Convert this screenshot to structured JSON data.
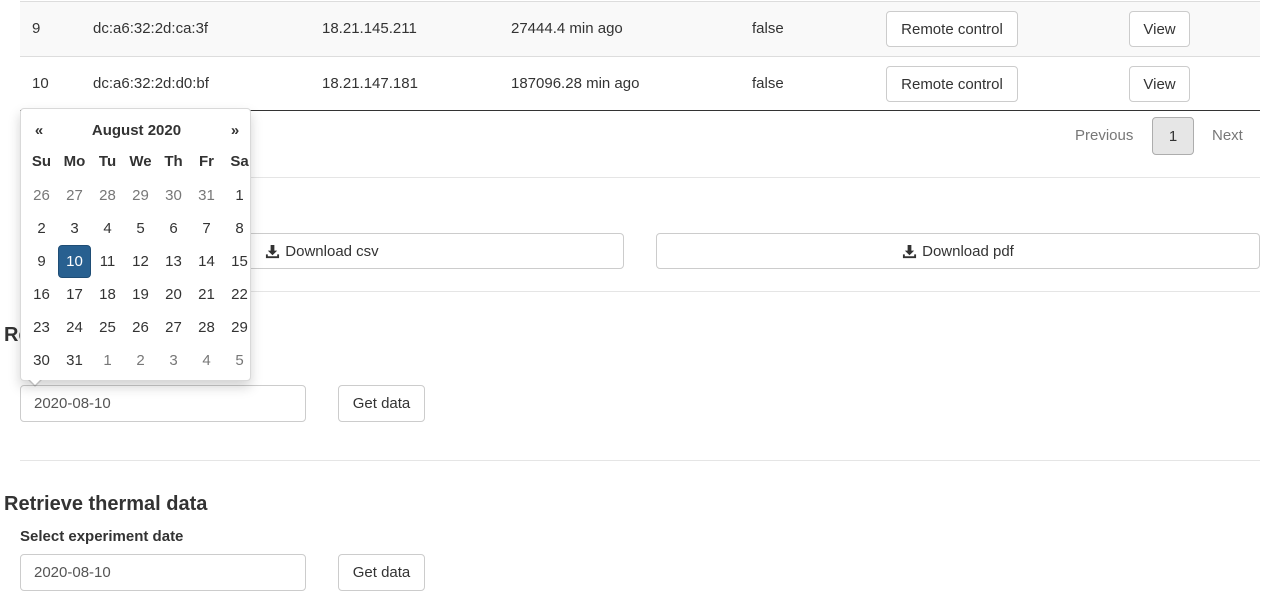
{
  "table": {
    "rows": [
      {
        "idx": "9",
        "mac": "dc:a6:32:2d:ca:3f",
        "ip": "18.21.145.211",
        "last_seen": "27444.4 min ago",
        "status": "false",
        "remote_label": "Remote control",
        "view_label": "View"
      },
      {
        "idx": "10",
        "mac": "dc:a6:32:2d:d0:bf",
        "ip": "18.21.147.181",
        "last_seen": "187096.28 min ago",
        "status": "false",
        "remote_label": "Remote control",
        "view_label": "View"
      }
    ]
  },
  "pagination": {
    "previous": "Previous",
    "current_page": "1",
    "next": "Next"
  },
  "downloads": {
    "csv_label": "Download csv",
    "pdf_label": "Download pdf",
    "icon": "download-icon"
  },
  "section_partial": {
    "title_visible": "Re",
    "date_value": "2020-08-10",
    "get_data_label": "Get data"
  },
  "thermal": {
    "title": "Retrieve thermal data",
    "date_label": "Select experiment date",
    "date_value": "2020-08-10",
    "get_data_label": "Get data"
  },
  "datepicker": {
    "prev": "«",
    "next": "»",
    "month_title": "August 2020",
    "weekdays": [
      "Su",
      "Mo",
      "Tu",
      "We",
      "Th",
      "Fr",
      "Sa"
    ],
    "weeks": [
      [
        "26",
        "27",
        "28",
        "29",
        "30",
        "31",
        "1"
      ],
      [
        "2",
        "3",
        "4",
        "5",
        "6",
        "7",
        "8"
      ],
      [
        "9",
        "10",
        "11",
        "12",
        "13",
        "14",
        "15"
      ],
      [
        "16",
        "17",
        "18",
        "19",
        "20",
        "21",
        "22"
      ],
      [
        "23",
        "24",
        "25",
        "26",
        "27",
        "28",
        "29"
      ],
      [
        "30",
        "31",
        "1",
        "2",
        "3",
        "4",
        "5"
      ]
    ],
    "selected_day": "10",
    "active_color": "#286090"
  }
}
